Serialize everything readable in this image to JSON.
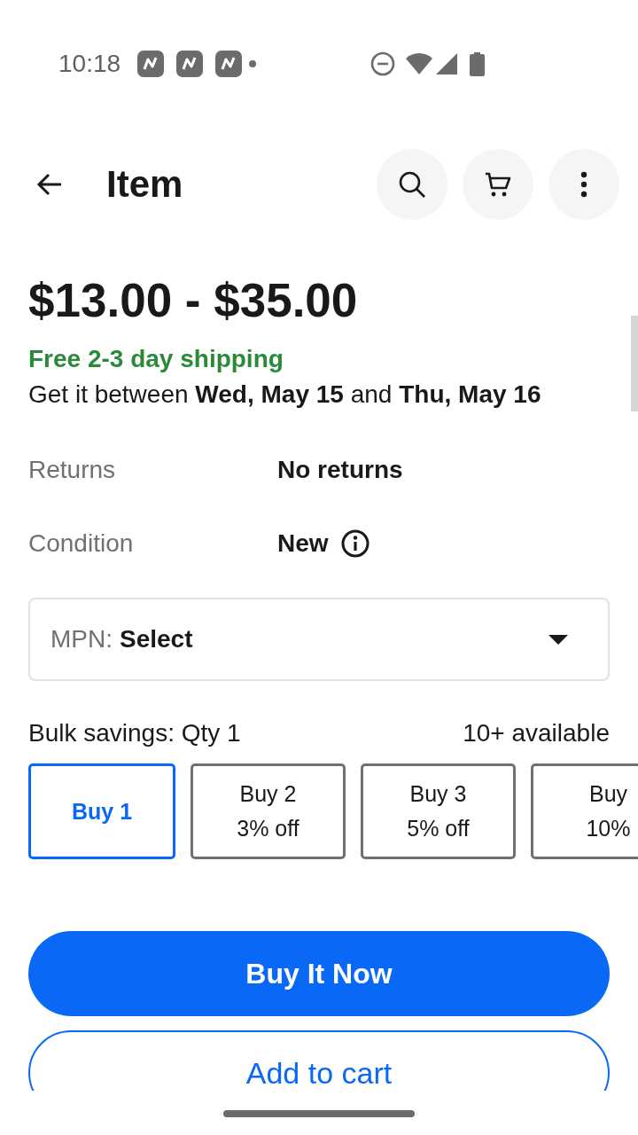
{
  "status_bar": {
    "time": "10:18"
  },
  "app_bar": {
    "title": "Item"
  },
  "price": "$13.00 - $35.00",
  "shipping": {
    "headline": "Free 2-3 day shipping",
    "delivery": "Get it between **Wed, May 15** and **Thu, May 16**"
  },
  "details": [
    {
      "label": "Returns",
      "value": "No returns",
      "info_icon": false
    },
    {
      "label": "Condition",
      "value": "New",
      "info_icon": true
    }
  ],
  "variation_select": {
    "label": "MPN:",
    "value": "Select"
  },
  "bulk_savings": {
    "label": "Bulk savings: Qty 1",
    "availability": "10+ available",
    "options": [
      {
        "title": "Buy 1",
        "selected": true
      },
      {
        "title": "Buy 2",
        "discount": "3% off",
        "selected": false
      },
      {
        "title": "Buy 3",
        "discount": "5% off",
        "selected": false
      },
      {
        "title": "Buy",
        "discount": "10%",
        "selected": false
      }
    ]
  },
  "actions": [
    {
      "label": "Buy It Now",
      "kind": "primary"
    },
    {
      "label": "Add to cart",
      "kind": "secondary"
    }
  ]
}
